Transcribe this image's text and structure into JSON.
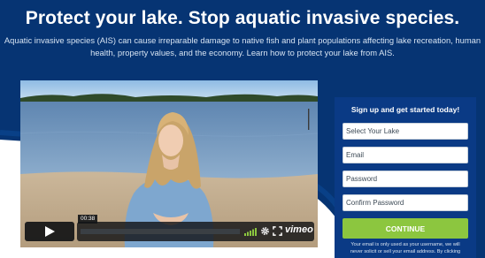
{
  "hero": {
    "title": "Protect your lake. Stop aquatic invasive species.",
    "subtitle": "Aquatic invasive species (AIS) can cause irreparable damage to native fish and plant populations affecting lake recreation, human health, property values, and the economy. Learn how to protect your lake from AIS.",
    "bg_color": "#063473"
  },
  "video": {
    "timestamp": "00:38",
    "progress_fraction": 0.0,
    "logo": "vimeo",
    "icons": [
      "play-icon",
      "volume-icon",
      "gear-icon",
      "fullscreen-icon"
    ]
  },
  "signup": {
    "title": "Sign up and get started today!",
    "lake_select": "Select Your Lake",
    "email_placeholder": "Email",
    "password_placeholder": "Password",
    "confirm_placeholder": "Confirm Password",
    "button_label": "CONTINUE",
    "disclaimer": "Your email is only used as your username, we will never solicit or sell your email address. By clicking",
    "panel_color": "#0a3a85",
    "button_color": "#8cc63f"
  }
}
